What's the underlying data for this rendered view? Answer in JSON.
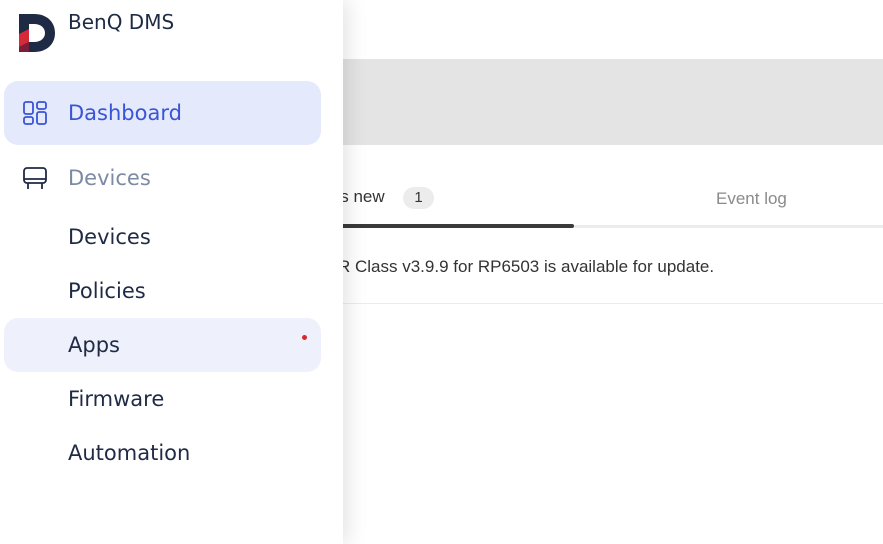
{
  "app": {
    "name": "BenQ DMS"
  },
  "main": {
    "tabs": [
      {
        "label": "'s new",
        "badge": "1"
      },
      {
        "label": "Event log"
      }
    ],
    "notice": "R Class v3.9.9 for RP6503 is available for update."
  },
  "sidebar": {
    "dashboard": {
      "label": "Dashboard",
      "icon": "dashboard-grid-icon"
    },
    "devices_group": {
      "label": "Devices",
      "icon": "display-stand-icon"
    },
    "sub_items": [
      {
        "label": "Devices"
      },
      {
        "label": "Policies"
      },
      {
        "label": "Apps",
        "has_notification": true
      },
      {
        "label": "Firmware"
      },
      {
        "label": "Automation"
      }
    ]
  },
  "colors": {
    "accent": "#3a54d6",
    "active_bg": "#e4e9fb",
    "hover_bg": "#eef1fc",
    "logo_navy": "#1f2a44",
    "logo_red": "#d42a3a",
    "notification": "#d42a2a"
  }
}
